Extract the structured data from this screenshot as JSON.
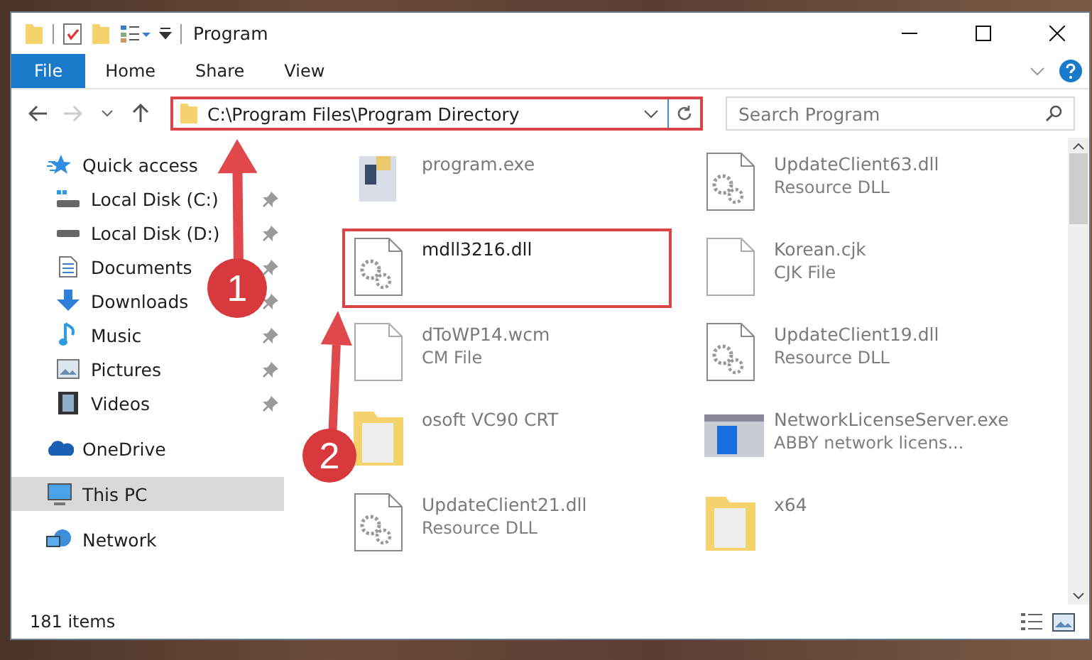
{
  "window": {
    "title": "Program"
  },
  "ribbon_tabs": [
    {
      "label": "File",
      "selected": true
    },
    {
      "label": "Home",
      "selected": false
    },
    {
      "label": "Share",
      "selected": false
    },
    {
      "label": "View",
      "selected": false
    }
  ],
  "address_bar": {
    "path": "C:\\Program Files\\Program Directory",
    "highlighted": true
  },
  "search": {
    "placeholder": "Search Program"
  },
  "sidebar": {
    "items": [
      {
        "label": "Quick access",
        "kind": "star",
        "selected": false,
        "children": [
          {
            "label": "Local Disk (C:)",
            "kind": "system-drive",
            "pinned": true,
            "selected": false
          },
          {
            "label": "Local Disk (D:)",
            "kind": "drive",
            "pinned": true,
            "selected": false
          },
          {
            "label": "Documents",
            "kind": "documents",
            "pinned": true,
            "selected": false
          },
          {
            "label": "Downloads",
            "kind": "downloads",
            "pinned": true,
            "selected": false
          },
          {
            "label": "Music",
            "kind": "music",
            "pinned": true,
            "selected": false
          },
          {
            "label": "Pictures",
            "kind": "pictures",
            "pinned": true,
            "selected": false
          },
          {
            "label": "Videos",
            "kind": "videos",
            "pinned": true,
            "selected": false
          }
        ]
      },
      {
        "label": "OneDrive",
        "kind": "cloud",
        "selected": false
      },
      {
        "label": "This PC",
        "kind": "computer",
        "selected": true
      },
      {
        "label": "Network",
        "kind": "network",
        "selected": false
      }
    ]
  },
  "files": [
    {
      "name": "program.exe",
      "kind": "exe",
      "blurred": true,
      "highlighted": false
    },
    {
      "name": "UpdateClient63.dll",
      "type": "Resource DLL",
      "kind": "dll",
      "blurred": true,
      "highlighted": false
    },
    {
      "name": "mdll3216.dll",
      "kind": "dll",
      "blurred": false,
      "highlighted": true
    },
    {
      "name": "Korean.cjk",
      "type": "CJK File",
      "kind": "blank",
      "blurred": true,
      "highlighted": false
    },
    {
      "name": "dToWP14.wcm",
      "type": "CM File",
      "kind": "blank",
      "blurred": true,
      "highlighted": false
    },
    {
      "name": "UpdateClient19.dll",
      "type": "Resource DLL",
      "kind": "dll",
      "blurred": true,
      "highlighted": false
    },
    {
      "name": "osoft VC90 CRT",
      "kind": "folder",
      "blurred": true,
      "highlighted": false
    },
    {
      "name": "NetworkLicenseServer.exe",
      "type": "ABBY network licens...",
      "kind": "app",
      "blurred": true,
      "highlighted": false
    },
    {
      "name": "UpdateClient21.dll",
      "type": "Resource DLL",
      "kind": "dll",
      "blurred": true,
      "highlighted": false
    },
    {
      "name": "x64",
      "kind": "folder",
      "blurred": true,
      "highlighted": false
    }
  ],
  "annotations": [
    {
      "label": "1"
    },
    {
      "label": "2"
    }
  ],
  "status_bar": {
    "item_count": "181 items"
  }
}
